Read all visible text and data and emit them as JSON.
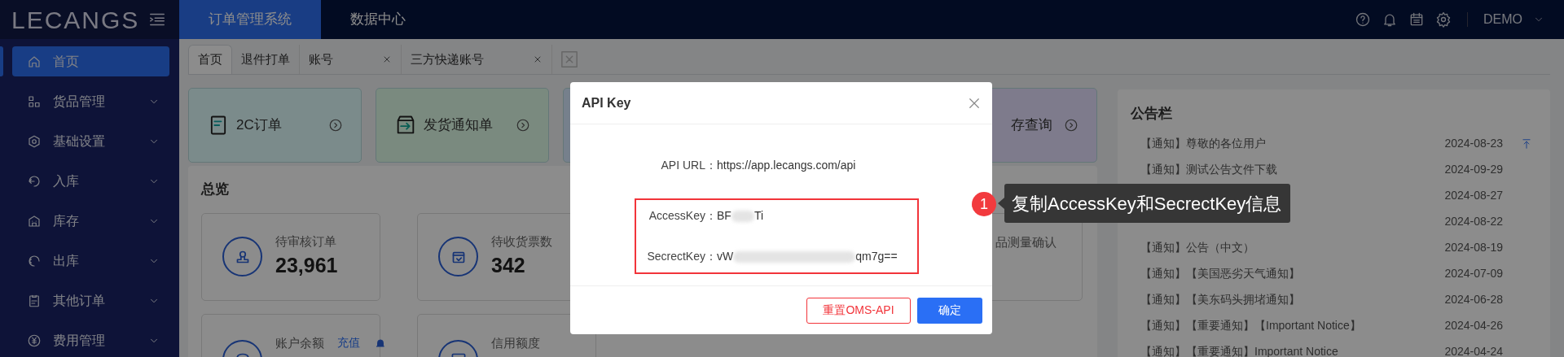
{
  "header": {
    "logo": "LECANGS",
    "systems": [
      {
        "label": "订单管理系统",
        "selected": true
      },
      {
        "label": "数据中心",
        "selected": false
      }
    ],
    "user": "DEMO"
  },
  "sidebar": {
    "items": [
      {
        "label": "首页",
        "selected": true,
        "expandable": false
      },
      {
        "label": "货品管理",
        "selected": false,
        "expandable": true
      },
      {
        "label": "基础设置",
        "selected": false,
        "expandable": true
      },
      {
        "label": "入库",
        "selected": false,
        "expandable": true
      },
      {
        "label": "库存",
        "selected": false,
        "expandable": true
      },
      {
        "label": "出库",
        "selected": false,
        "expandable": true
      },
      {
        "label": "其他订单",
        "selected": false,
        "expandable": true
      },
      {
        "label": "费用管理",
        "selected": false,
        "expandable": true
      }
    ]
  },
  "tabs": [
    {
      "label": "首页",
      "selected": true,
      "closable": false
    },
    {
      "label": "退件打单",
      "selected": false,
      "closable": false
    },
    {
      "label": "账号",
      "selected": false,
      "closable": true
    },
    {
      "label": "三方快递账号",
      "selected": false,
      "closable": true
    }
  ],
  "quick_cards": [
    {
      "label": "2C订单",
      "color": "#7c8b8b"
    },
    {
      "label": "发货通知单",
      "color": "#7a8a7f"
    },
    {
      "color": "#76808c"
    },
    {
      "label": "存查询",
      "color": "#7e7b8c"
    }
  ],
  "overview": {
    "title": "总览",
    "stats": [
      {
        "label": "待审核订单",
        "value": "23,961"
      },
      {
        "label": "待收货票数",
        "value": "342"
      },
      {
        "label": "品测量确认"
      }
    ],
    "stats_row2": [
      {
        "label": "账户余额",
        "link": "充值"
      },
      {
        "label": "信用额度"
      }
    ]
  },
  "notices": {
    "title": "公告栏",
    "items": [
      {
        "title": "【通知】尊敬的各位用户",
        "date": "2024-08-23",
        "pinned": true
      },
      {
        "title": "【通知】测试公告文件下载",
        "date": "2024-09-29",
        "pinned": false
      },
      {
        "date": "2024-08-27",
        "pinned": false
      },
      {
        "date": "2024-08-22",
        "pinned": false
      },
      {
        "title": "【通知】公告（中文）",
        "date": "2024-08-19",
        "pinned": false
      },
      {
        "title": "【通知】【美国恶劣天气通知】",
        "date": "2024-07-09",
        "pinned": false
      },
      {
        "title": "【通知】【美东码头拥堵通知】",
        "date": "2024-06-28",
        "pinned": false
      },
      {
        "title": "【通知】【重要通知】【Important Notice】",
        "date": "2024-04-26",
        "pinned": false
      },
      {
        "title": "【通知】【重要通知】Important Notice",
        "date": "2024-04-24",
        "pinned": false
      }
    ]
  },
  "modal": {
    "title": "API Key",
    "fields": [
      {
        "label": "API URL：",
        "value": "https://app.lecangs.com/api"
      }
    ],
    "highlighted_fields": [
      {
        "label": "AccessKey：",
        "value_start": "BF",
        "value_end": "Ti"
      },
      {
        "label": "SecrectKey：",
        "value_start": "vW",
        "value_end": "qm7g=="
      }
    ],
    "buttons": [
      {
        "label": "重置OMS-API",
        "kind": "danger-outline"
      },
      {
        "label": "确定",
        "kind": "primary"
      }
    ]
  },
  "annotation": {
    "number": "1",
    "text": "复制AccessKey和SecrectKey信息"
  }
}
